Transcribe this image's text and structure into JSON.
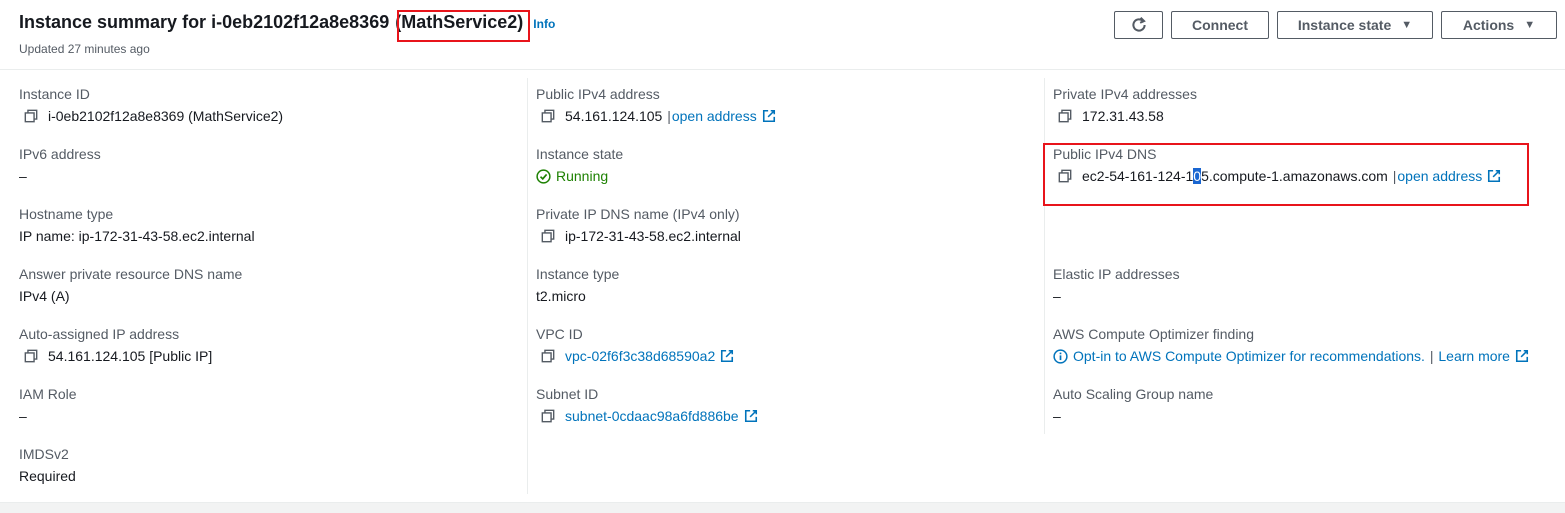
{
  "header": {
    "title_prefix": "Instance summary for i-0eb2102f12a8e8369",
    "title_name": "(MathService2)",
    "info_label": "Info",
    "updated": "Updated 27 minutes ago"
  },
  "toolbar": {
    "connect_label": "Connect",
    "instance_state_label": "Instance state",
    "actions_label": "Actions"
  },
  "col1": {
    "instance_id_label": "Instance ID",
    "instance_id_value": "i-0eb2102f12a8e8369 (MathService2)",
    "ipv6_label": "IPv6 address",
    "ipv6_value": "–",
    "hostname_type_label": "Hostname type",
    "hostname_type_value": "IP name: ip-172-31-43-58.ec2.internal",
    "answer_dns_label": "Answer private resource DNS name",
    "answer_dns_value": "IPv4 (A)",
    "auto_ip_label": "Auto-assigned IP address",
    "auto_ip_value": "54.161.124.105 [Public IP]",
    "iam_label": "IAM Role",
    "iam_value": "–",
    "imds_label": "IMDSv2",
    "imds_value": "Required"
  },
  "col2": {
    "public_ipv4_label": "Public IPv4 address",
    "public_ipv4_value": "54.161.124.105",
    "open_address": "open address",
    "state_label": "Instance state",
    "state_value": "Running",
    "private_dns_label": "Private IP DNS name (IPv4 only)",
    "private_dns_value": "ip-172-31-43-58.ec2.internal",
    "type_label": "Instance type",
    "type_value": "t2.micro",
    "vpc_label": "VPC ID",
    "vpc_value": "vpc-02f6f3c38d68590a2",
    "subnet_label": "Subnet ID",
    "subnet_value": "subnet-0cdaac98a6fd886be"
  },
  "col3": {
    "private_ipv4_label": "Private IPv4 addresses",
    "private_ipv4_value": "172.31.43.58",
    "public_dns_label": "Public IPv4 DNS",
    "public_dns_pre": "ec2-54-161-124-1",
    "public_dns_sel": "0",
    "public_dns_post": "5.compute-1.amazonaws.com",
    "open_address": "open address",
    "elastic_label": "Elastic IP addresses",
    "elastic_value": "–",
    "optimizer_label": "AWS Compute Optimizer finding",
    "optimizer_value": "Opt-in to AWS Compute Optimizer for recommendations.",
    "learn_more": "Learn more",
    "asg_label": "Auto Scaling Group name",
    "asg_value": "–"
  },
  "colors": {
    "link": "#0073bb",
    "running": "#1d8102",
    "highlight": "#e8141b"
  }
}
